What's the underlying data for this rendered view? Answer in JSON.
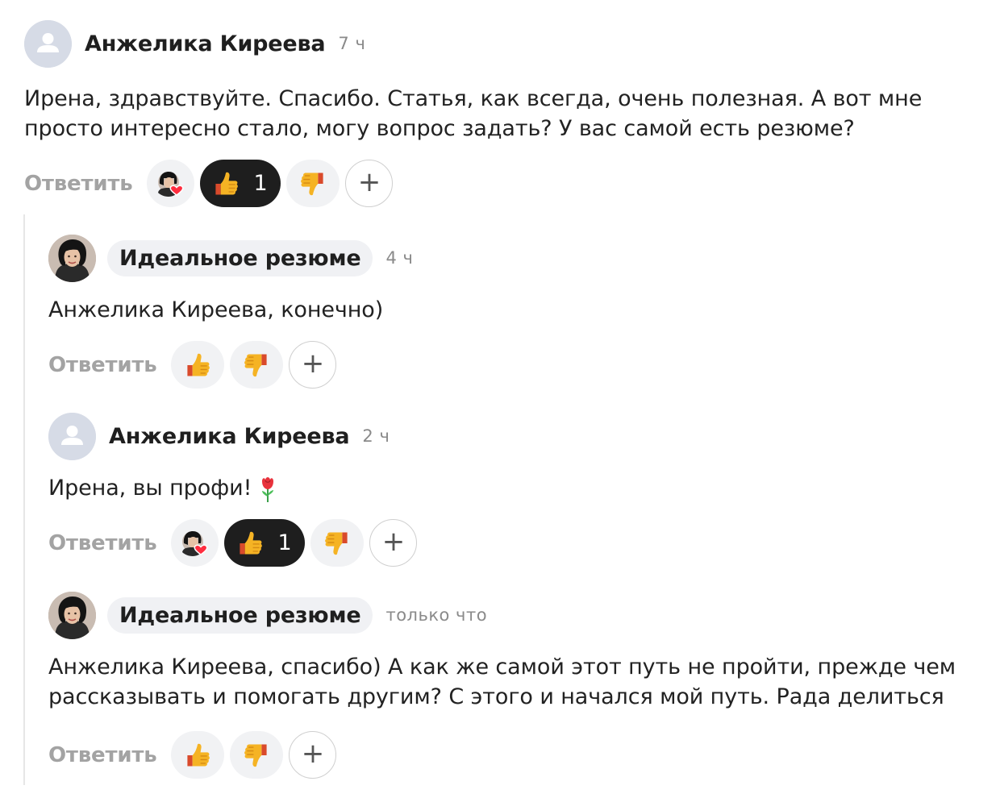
{
  "comments": [
    {
      "author": "Анжелика Киреева",
      "time": "7 ч",
      "text": "Ирена, здравствуйте. Спасибо. Статья, как всегда, очень полезная. А вот мне просто интересно стало, могу вопрос задать? У вас самой есть резюме?",
      "reply_label": "Ответить",
      "like_count": "1"
    },
    {
      "author": "Идеальное резюме",
      "time": "4 ч",
      "text": "Анжелика Киреева, конечно)",
      "reply_label": "Ответить"
    },
    {
      "author": "Анжелика Киреева",
      "time": "2 ч",
      "text": "Ирена, вы профи!",
      "emoji": "rose-icon",
      "reply_label": "Ответить",
      "like_count": "1"
    },
    {
      "author": "Идеальное резюме",
      "time": "только что",
      "text": "Анжелика Киреева, спасибо) А как же самой этот путь не пройти, прежде чем рассказывать и помогать другим? С этого и начался мой путь. Рада делиться",
      "reply_label": "Ответить"
    }
  ],
  "icons": {
    "like": "thumbs-up-icon",
    "dislike": "thumbs-down-icon",
    "add_reaction": "plus-icon",
    "reactor": "reactor-avatar-heart-icon"
  },
  "colors": {
    "active_pill": "#1e1e1e",
    "pill": "#f1f2f4",
    "muted_text": "#a3a3a3",
    "chip": "#f0f1f4"
  }
}
